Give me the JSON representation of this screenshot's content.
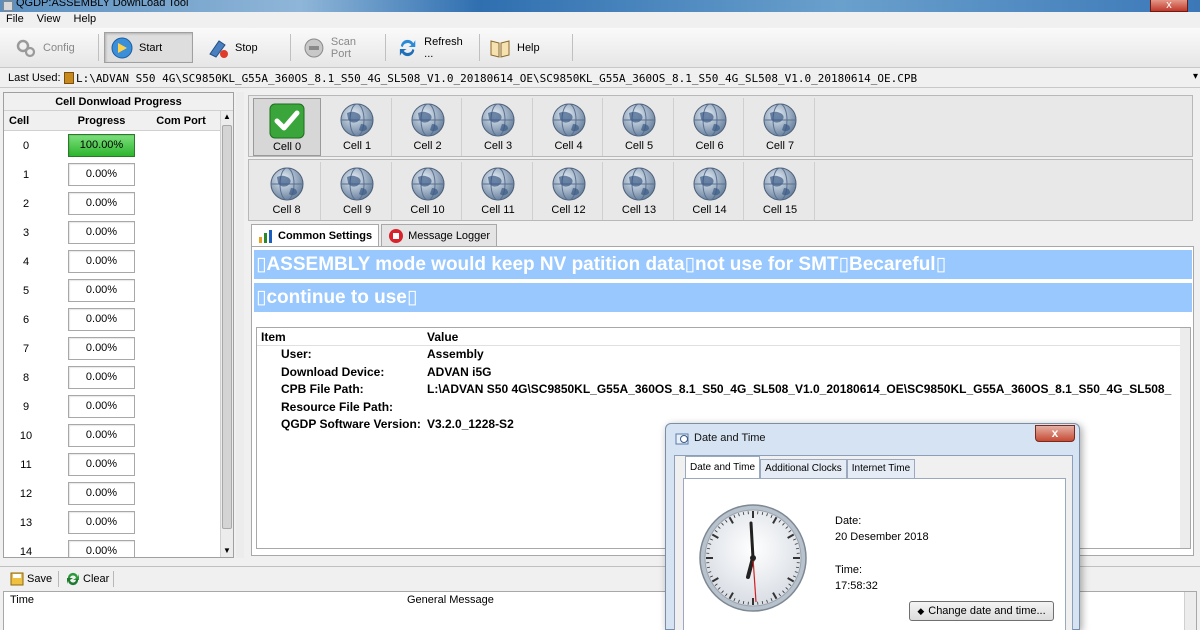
{
  "window": {
    "title": "QGDP:ASSEMBLY  DownLoad Tool",
    "close_glyph": "x"
  },
  "menu": [
    "File",
    "View",
    "Help"
  ],
  "toolbar": {
    "config": "Config",
    "start": "Start",
    "stop": "Stop",
    "scan_port": "Scan Port",
    "refresh": "Refresh ...",
    "help": "Help"
  },
  "last_used": {
    "label": "Last Used:",
    "path": "L:\\ADVAN S50 4G\\SC9850KL_G55A_360OS_8.1_S50_4G_SL508_V1.0_20180614_OE\\SC9850KL_G55A_360OS_8.1_S50_4G_SL508_V1.0_20180614_OE.CPB"
  },
  "progress_panel": {
    "title": "Cell Donwload Progress",
    "columns": [
      "Cell",
      "Progress",
      "Com Port"
    ],
    "rows": [
      {
        "cell": "0",
        "progress": "100.00%",
        "done": true
      },
      {
        "cell": "1",
        "progress": "0.00%"
      },
      {
        "cell": "2",
        "progress": "0.00%"
      },
      {
        "cell": "3",
        "progress": "0.00%"
      },
      {
        "cell": "4",
        "progress": "0.00%"
      },
      {
        "cell": "5",
        "progress": "0.00%"
      },
      {
        "cell": "6",
        "progress": "0.00%"
      },
      {
        "cell": "7",
        "progress": "0.00%"
      },
      {
        "cell": "8",
        "progress": "0.00%"
      },
      {
        "cell": "9",
        "progress": "0.00%"
      },
      {
        "cell": "10",
        "progress": "0.00%"
      },
      {
        "cell": "11",
        "progress": "0.00%"
      },
      {
        "cell": "12",
        "progress": "0.00%"
      },
      {
        "cell": "13",
        "progress": "0.00%"
      },
      {
        "cell": "14",
        "progress": "0.00%"
      }
    ]
  },
  "cells_row1": [
    "Cell 0",
    "Cell 1",
    "Cell 2",
    "Cell 3",
    "Cell 4",
    "Cell 5",
    "Cell 6",
    "Cell 7"
  ],
  "cells_row2": [
    "Cell 8",
    "Cell 9",
    "Cell 10",
    "Cell 11",
    "Cell 12",
    "Cell 13",
    "Cell 14",
    "Cell 15"
  ],
  "tabs": {
    "common": "Common Settings",
    "logger": "Message Logger"
  },
  "banner": {
    "line1": "▯ASSEMBLY mode would keep NV patition data▯not use for SMT▯Becareful▯",
    "line2": "▯continue to use▯"
  },
  "info": {
    "col_item": "Item",
    "col_value": "Value",
    "rows": [
      {
        "k": "User:",
        "v": "Assembly"
      },
      {
        "k": "Download Device:",
        "v": "ADVAN i5G"
      },
      {
        "k": "CPB File Path:",
        "v": "L:\\ADVAN S50 4G\\SC9850KL_G55A_360OS_8.1_S50_4G_SL508_V1.0_20180614_OE\\SC9850KL_G55A_360OS_8.1_S50_4G_SL508_"
      },
      {
        "k": "Resource File Path:",
        "v": ""
      },
      {
        "k": "QGDP Software Version:",
        "v": "V3.2.0_1228-S2"
      }
    ]
  },
  "bottom": {
    "save": "Save",
    "clear": "Clear",
    "col_time": "Time",
    "col_msg": "General Message"
  },
  "datetime": {
    "title": "Date and Time",
    "close_glyph": "x",
    "tabs": [
      "Date and Time",
      "Additional Clocks",
      "Internet Time"
    ],
    "date_label": "Date:",
    "date_value": "20 Desember 2018",
    "time_label": "Time:",
    "time_value": "17:58:32",
    "change_button": "Change date and time..."
  },
  "colors": {
    "banner": "#99c8ff",
    "progress_done": "#2db52d",
    "accent": "#1a6fc9"
  }
}
